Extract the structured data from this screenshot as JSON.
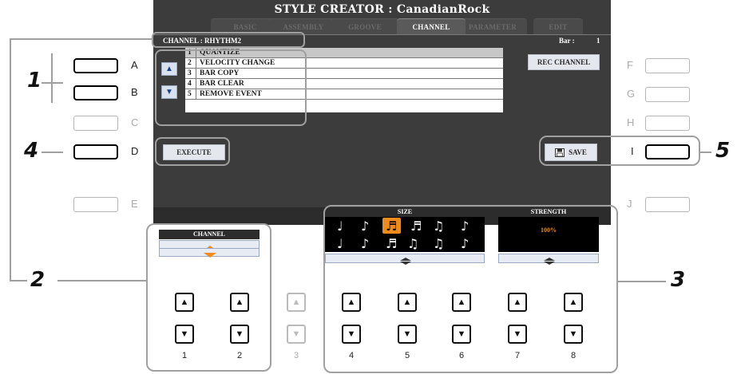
{
  "title": "STYLE CREATOR : CanadianRock",
  "tabs": [
    "BASIC",
    "ASSEMBLY",
    "GROOVE",
    "CHANNEL",
    "PARAMETER",
    "EDIT"
  ],
  "active_tab": "CHANNEL",
  "channel_label": "CHANNEL : RHYTHM2",
  "bar_label": "Bar :",
  "bar_value": "1",
  "menu": [
    {
      "num": "1",
      "label": "QUANTIZE",
      "selected": true
    },
    {
      "num": "2",
      "label": "VELOCITY CHANGE",
      "selected": false
    },
    {
      "num": "3",
      "label": "BAR COPY",
      "selected": false
    },
    {
      "num": "4",
      "label": "BAR CLEAR",
      "selected": false
    },
    {
      "num": "5",
      "label": "REMOVE EVENT",
      "selected": false
    }
  ],
  "rec_channel_label": "REC CHANNEL",
  "execute_label": "EXECUTE",
  "save_label": "SAVE",
  "channel_dial_label": "CHANNEL",
  "size_label": "SIZE",
  "strength_label": "STRENGTH",
  "strength_value": "100%",
  "left_buttons": [
    "A",
    "B",
    "C",
    "D",
    "E"
  ],
  "right_buttons": [
    "F",
    "G",
    "H",
    "I",
    "J"
  ],
  "dial_numbers": [
    "1",
    "2",
    "3",
    "4",
    "5",
    "6",
    "7",
    "8"
  ],
  "callouts": [
    "1",
    "2",
    "3",
    "4",
    "5"
  ],
  "colors": {
    "accent": "#f08a1c",
    "lcd_bg": "#3c3c3c",
    "highlight": "#000000"
  }
}
